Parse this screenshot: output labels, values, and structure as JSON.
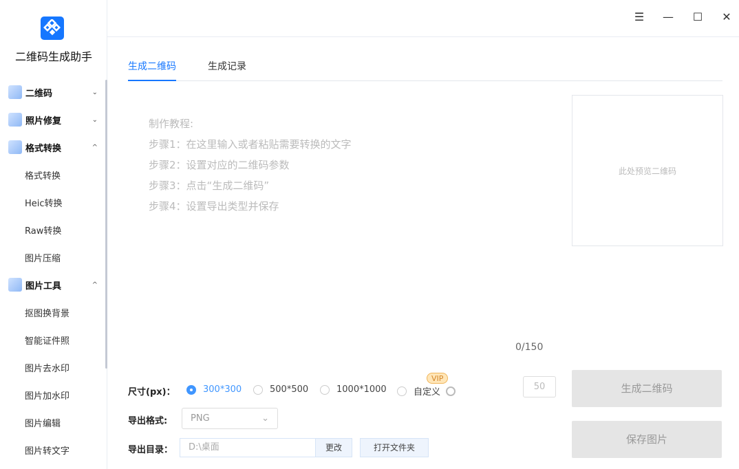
{
  "app": {
    "title": "二维码生成助手"
  },
  "sidebar": {
    "groups": [
      {
        "label": "二维码",
        "chevron": "⌄"
      },
      {
        "label": "照片修复",
        "chevron": "⌄"
      },
      {
        "label": "格式转换",
        "chevron": "⌃",
        "items": [
          "格式转换",
          "Heic转换",
          "Raw转换",
          "图片压缩"
        ]
      },
      {
        "label": "图片工具",
        "chevron": "⌃",
        "items": [
          "抠图换背景",
          "智能证件照",
          "图片去水印",
          "图片加水印",
          "图片编辑",
          "图片转文字"
        ]
      }
    ]
  },
  "window": {
    "menu": "☰",
    "minimize": "—",
    "maximize": "☐",
    "close": "✕"
  },
  "tabs": [
    "生成二维码",
    "生成记录"
  ],
  "editor": {
    "lines": [
      "制作教程:",
      "步骤1：在这里输入或者粘贴需要转换的文字",
      "步骤2：设置对应的二维码参数",
      "步骤3：点击“生成二维码”",
      "步骤4：设置导出类型并保存"
    ],
    "count": "0/150"
  },
  "preview": {
    "placeholder": "此处预览二维码"
  },
  "size": {
    "label": "尺寸(px)：",
    "options": [
      "300*300",
      "500*500",
      "1000*1000",
      "自定义"
    ],
    "selected": "300*300",
    "vip": "VIP",
    "custom_value": "50"
  },
  "format": {
    "label": "导出格式:",
    "value": "PNG"
  },
  "directory": {
    "label": "导出目录：",
    "value": "D:\\桌面",
    "change": "更改",
    "open": "打开文件夹"
  },
  "actions": {
    "generate": "生成二维码",
    "save": "保存图片"
  }
}
